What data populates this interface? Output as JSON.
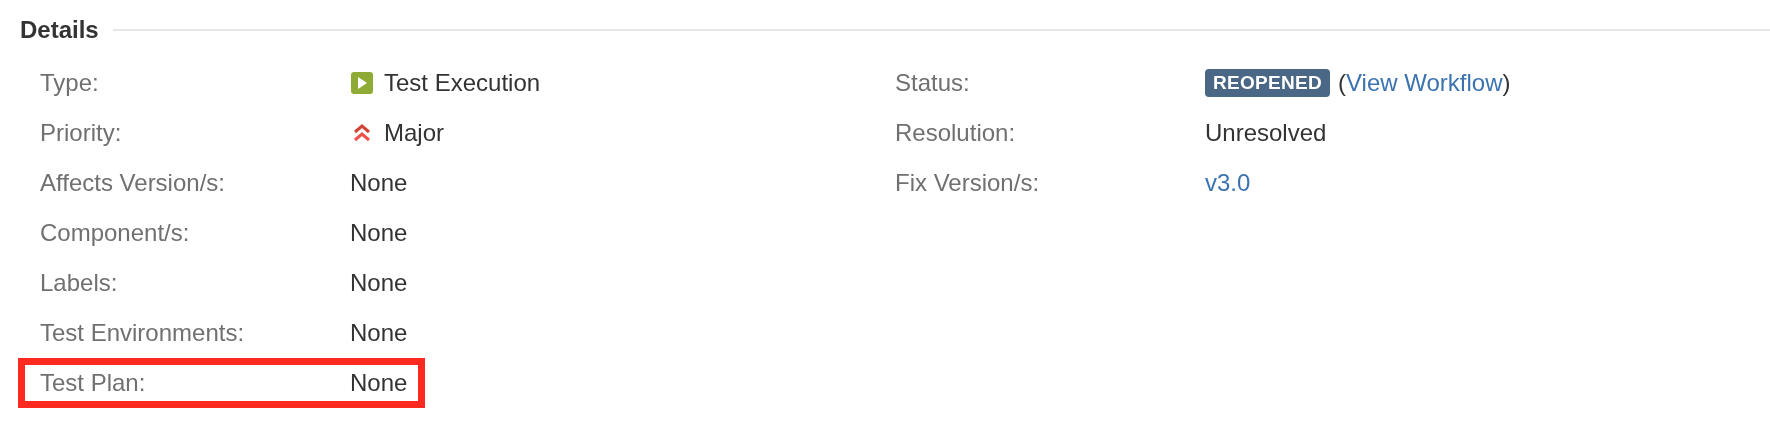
{
  "section": {
    "title": "Details"
  },
  "left_fields": [
    {
      "label": "Type:",
      "kind": "issue_type",
      "value": "Test Execution",
      "highlighted": false
    },
    {
      "label": "Priority:",
      "kind": "priority",
      "value": "Major",
      "highlighted": false
    },
    {
      "label": "Affects Version/s:",
      "kind": "text",
      "value": "None",
      "highlighted": false
    },
    {
      "label": "Component/s:",
      "kind": "text",
      "value": "None",
      "highlighted": false
    },
    {
      "label": "Labels:",
      "kind": "text",
      "value": "None",
      "highlighted": false
    },
    {
      "label": "Test Environments:",
      "kind": "text",
      "value": "None",
      "highlighted": false
    },
    {
      "label": "Test Plan:",
      "kind": "text",
      "value": "None",
      "highlighted": true
    }
  ],
  "right_fields": [
    {
      "label": "Status:",
      "kind": "status",
      "badge": "REOPENED",
      "open": "(",
      "link": "View Workflow",
      "close": ")",
      "highlighted": false
    },
    {
      "label": "Resolution:",
      "kind": "text",
      "value": "Unresolved",
      "highlighted": false
    },
    {
      "label": "Fix Version/s:",
      "kind": "link",
      "value": "v3.0",
      "highlighted": false
    }
  ]
}
